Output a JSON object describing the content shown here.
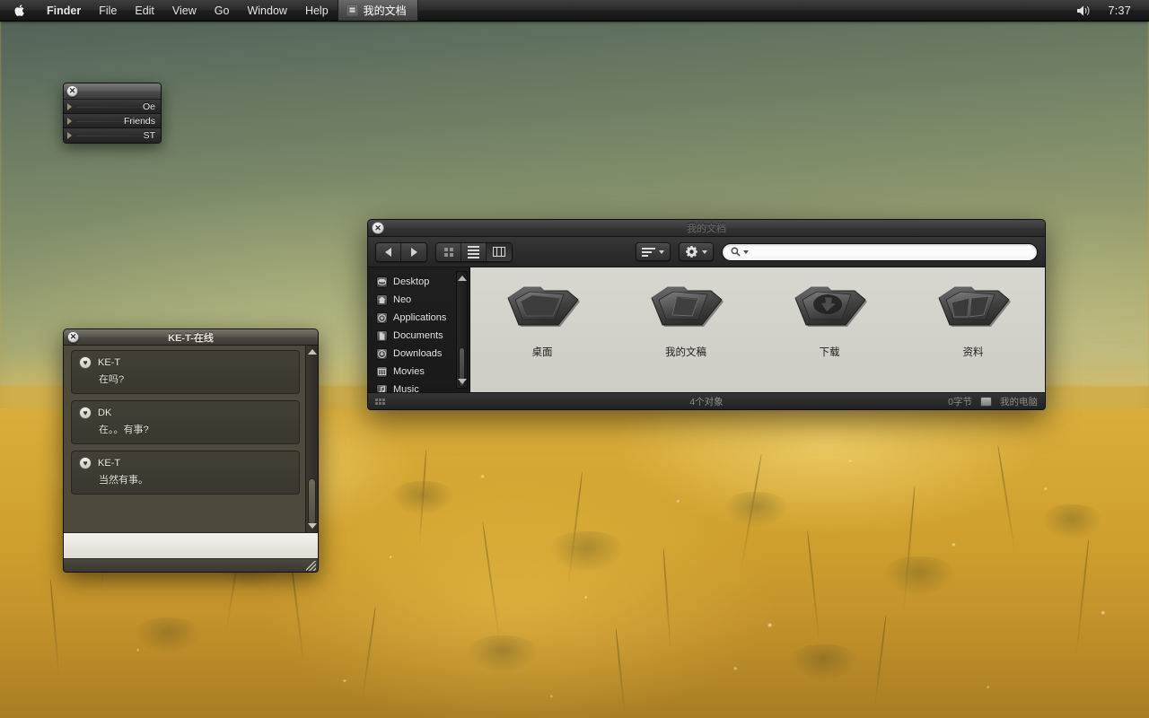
{
  "menubar": {
    "apple_glyph": "",
    "apple_icon": "apple-logo",
    "items": [
      {
        "label": "Finder",
        "bold": true
      },
      {
        "label": "File",
        "bold": false
      },
      {
        "label": "Edit",
        "bold": false
      },
      {
        "label": "View",
        "bold": false
      },
      {
        "label": "Go",
        "bold": false
      },
      {
        "label": "Window",
        "bold": false
      },
      {
        "label": "Help",
        "bold": false
      }
    ],
    "active_window": {
      "title": "我的文档",
      "icon": "window-proxy-icon"
    },
    "volume_icon": "speaker-volume-icon",
    "clock": "7:37"
  },
  "buddy_panel": {
    "close_glyph": "✕",
    "rows": [
      {
        "label": "Oe"
      },
      {
        "label": "Friends"
      },
      {
        "label": "ST"
      }
    ]
  },
  "chat_window": {
    "close_glyph": "✕",
    "title": "KE-T-在线",
    "messages": [
      {
        "badge": "♥",
        "name": "KE-T",
        "text": "在吗?"
      },
      {
        "badge": "♥",
        "name": "DK",
        "text": "在。。有事?"
      },
      {
        "badge": "♥",
        "name": "KE-T",
        "text": "当然有事。"
      }
    ],
    "input_value": "",
    "input_placeholder": "",
    "scrollbar": {
      "up_icon": "scroll-up-arrow",
      "down_icon": "scroll-down-arrow"
    },
    "resize_grip_icon": "resize-grip-icon"
  },
  "finder": {
    "close_glyph": "✕",
    "title": "我的文档",
    "toolbar": {
      "back_icon": "back-arrow-icon",
      "forward_icon": "forward-arrow-icon",
      "view_modes": [
        {
          "name": "icon-view",
          "icon": "grid-icon",
          "selected": false
        },
        {
          "name": "list-view",
          "icon": "list-icon",
          "selected": false
        },
        {
          "name": "column-view",
          "icon": "column-icon",
          "selected": true
        }
      ],
      "arrange_icon": "arrange-icon",
      "action_icon": "gear-icon",
      "search_icon": "search-magnifier-icon",
      "search_value": "",
      "search_placeholder": ""
    },
    "sidebar": {
      "items": [
        {
          "label": "Desktop",
          "icon": "desktop-icon"
        },
        {
          "label": "Neo",
          "icon": "home-icon"
        },
        {
          "label": "Applications",
          "icon": "applications-icon"
        },
        {
          "label": "Documents",
          "icon": "documents-icon"
        },
        {
          "label": "Downloads",
          "icon": "downloads-icon"
        },
        {
          "label": "Movies",
          "icon": "movies-icon"
        },
        {
          "label": "Music",
          "icon": "music-icon"
        }
      ],
      "scrollbar": {
        "up_icon": "scroll-up-arrow",
        "down_icon": "scroll-down-arrow"
      }
    },
    "files": [
      {
        "label": "桌面",
        "icon": "folder-desktop"
      },
      {
        "label": "我的文稿",
        "icon": "folder-documents"
      },
      {
        "label": "下载",
        "icon": "folder-downloads"
      },
      {
        "label": "资料",
        "icon": "folder-materials"
      }
    ],
    "statusbar": {
      "view_icon": "grid-view-icon",
      "item_count": "4个对象",
      "free_space": "0字节",
      "disk_icon": "hard-disk-icon",
      "location": "我的电脑"
    }
  },
  "theme": {
    "menubar_bg": "#1e1e1e",
    "window_chrome": "#2d2d2d",
    "file_pane_bg": "#d2d2ca",
    "accent_text": "#e6e6e6",
    "wallpaper_sky": "#7e8c6a",
    "wallpaper_field": "#cfa02e"
  }
}
